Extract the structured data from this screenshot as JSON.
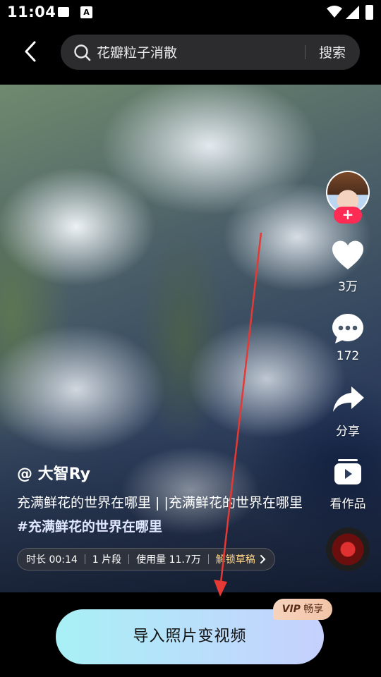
{
  "status_bar": {
    "time": "11:04"
  },
  "search": {
    "query": "花瓣粒子消散",
    "button_label": "搜索"
  },
  "author": "@ 大智Ry",
  "description": {
    "text": "充满鲜花的世界在哪里 | |充满鲜花的世界在哪里 ",
    "hashtag": "#充满鲜花的世界在哪里"
  },
  "template_info": {
    "duration": "时长 00:14",
    "segments": "1 片段",
    "usage": "使用量 11.7万",
    "unlock_label": "解锁草稿"
  },
  "rail": {
    "like_count": "3万",
    "comment_count": "172",
    "share_label": "分享",
    "works_label": "看作品"
  },
  "cta": {
    "label": "导入照片变视频",
    "badge_vip": "VIP",
    "badge_text": "畅享"
  },
  "colors": {
    "follow": "#fe2c55",
    "annotation_arrow": "#e53935",
    "unlock": "#ffd58a"
  }
}
